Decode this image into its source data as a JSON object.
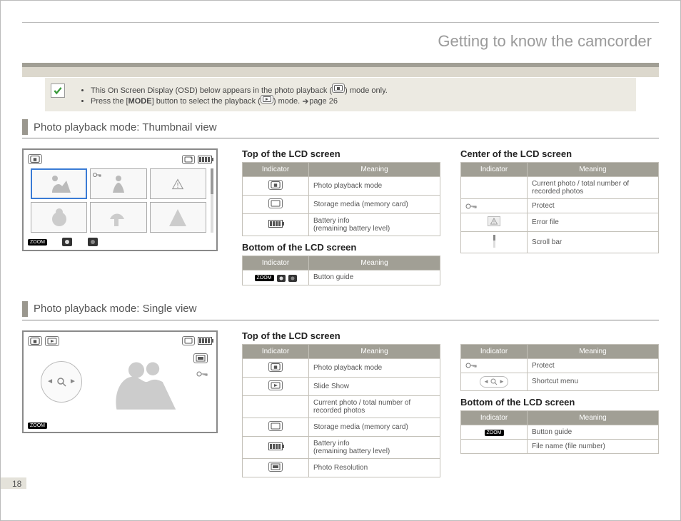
{
  "title": "Getting to know the camcorder",
  "page_number": "18",
  "note": {
    "line1_prefix": "This On Screen Display (OSD) below appears in the photo playback (",
    "line1_suffix": ") mode only.",
    "line2_prefix": "Press the [",
    "line2_mode": "MODE",
    "line2_mid": "] button to select the playback (",
    "line2_suffix": ") mode. ",
    "line2_page": "page 26"
  },
  "section1_title": "Photo playback mode: Thumbnail view",
  "section2_title": "Photo playback mode: Single view",
  "headers": {
    "indicator": "Indicator",
    "meaning": "Meaning"
  },
  "thumb": {
    "top_title": "Top of the LCD screen",
    "top_rows": [
      {
        "m": "Photo playback mode"
      },
      {
        "m": "Storage media (memory card)"
      },
      {
        "m": "Battery info\n(remaining battery level)"
      }
    ],
    "bottom_title": "Bottom of the LCD screen",
    "bottom_rows": [
      {
        "m": "Button guide"
      }
    ],
    "center_title": "Center of the LCD screen",
    "center_rows": [
      {
        "m": "Current photo / total number of recorded photos"
      },
      {
        "m": "Protect"
      },
      {
        "m": "Error file"
      },
      {
        "m": "Scroll bar"
      }
    ]
  },
  "single": {
    "top_title": "Top of the LCD screen",
    "left_rows": [
      {
        "m": "Photo playback mode"
      },
      {
        "m": "Slide Show"
      },
      {
        "m": "Current photo / total number of recorded photos"
      },
      {
        "m": "Storage media (memory card)"
      },
      {
        "m": "Battery info\n(remaining battery level)"
      },
      {
        "m": "Photo Resolution"
      }
    ],
    "right_rows": [
      {
        "m": "Protect"
      },
      {
        "m": "Shortcut menu"
      }
    ],
    "bottom_title": "Bottom of the LCD screen",
    "bottom_rows": [
      {
        "m": "Button guide"
      },
      {
        "m": "File name (file number)"
      }
    ]
  },
  "labels": {
    "zoom": "ZOOM"
  }
}
